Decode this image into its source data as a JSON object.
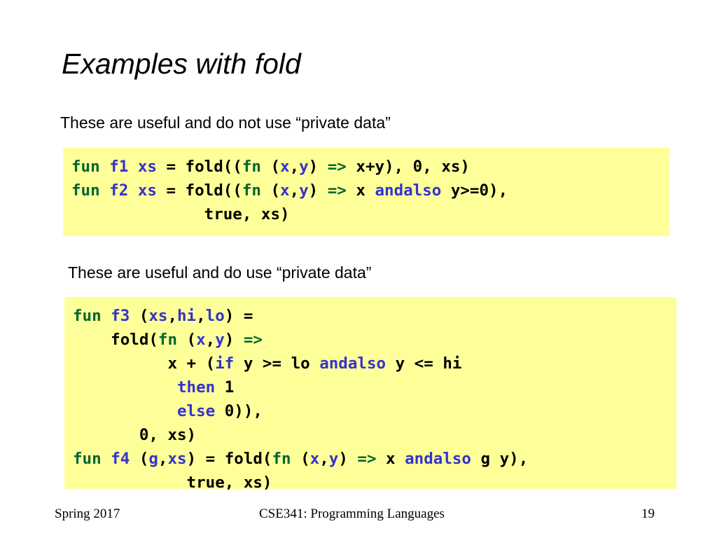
{
  "slide": {
    "title": "Examples with fold",
    "bullets": [
      "These are useful and do not use “private data”",
      "These are useful and do use “private data”"
    ],
    "code_block_1": {
      "background_color": "#ffff99",
      "lines": [
        {
          "tokens": [
            {
              "t": "fun ",
              "c": "keyword"
            },
            {
              "t": "f1 xs",
              "c": "identifier"
            },
            {
              "t": " = fold((",
              "c": "plain"
            },
            {
              "t": "fn",
              "c": "keyword"
            },
            {
              "t": " (",
              "c": "plain"
            },
            {
              "t": "x",
              "c": "identifier"
            },
            {
              "t": ",",
              "c": "plain"
            },
            {
              "t": "y",
              "c": "identifier"
            },
            {
              "t": ") ",
              "c": "plain"
            },
            {
              "t": "=>",
              "c": "keyword"
            },
            {
              "t": " x+y), 0, xs)",
              "c": "plain"
            }
          ]
        },
        {
          "tokens": [
            {
              "t": "fun ",
              "c": "keyword"
            },
            {
              "t": "f2 xs",
              "c": "identifier"
            },
            {
              "t": " = fold((",
              "c": "plain"
            },
            {
              "t": "fn",
              "c": "keyword"
            },
            {
              "t": " (",
              "c": "plain"
            },
            {
              "t": "x",
              "c": "identifier"
            },
            {
              "t": ",",
              "c": "plain"
            },
            {
              "t": "y",
              "c": "identifier"
            },
            {
              "t": ") ",
              "c": "plain"
            },
            {
              "t": "=>",
              "c": "keyword"
            },
            {
              "t": " x ",
              "c": "plain"
            },
            {
              "t": "andalso",
              "c": "control"
            },
            {
              "t": " y>=0),",
              "c": "plain"
            }
          ]
        },
        {
          "tokens": [
            {
              "t": "              true, xs)",
              "c": "plain"
            }
          ]
        }
      ]
    },
    "code_block_2": {
      "background_color": "#ffff99",
      "lines": [
        {
          "tokens": [
            {
              "t": "fun ",
              "c": "keyword"
            },
            {
              "t": "f3",
              "c": "identifier"
            },
            {
              "t": " (",
              "c": "plain"
            },
            {
              "t": "xs",
              "c": "identifier"
            },
            {
              "t": ",",
              "c": "plain"
            },
            {
              "t": "hi",
              "c": "identifier"
            },
            {
              "t": ",",
              "c": "plain"
            },
            {
              "t": "lo",
              "c": "identifier"
            },
            {
              "t": ") =",
              "c": "plain"
            }
          ]
        },
        {
          "tokens": [
            {
              "t": "    fold(",
              "c": "plain"
            },
            {
              "t": "fn",
              "c": "keyword"
            },
            {
              "t": " (",
              "c": "plain"
            },
            {
              "t": "x",
              "c": "identifier"
            },
            {
              "t": ",",
              "c": "plain"
            },
            {
              "t": "y",
              "c": "identifier"
            },
            {
              "t": ") ",
              "c": "plain"
            },
            {
              "t": "=>",
              "c": "keyword"
            }
          ]
        },
        {
          "tokens": [
            {
              "t": "          x + (",
              "c": "plain"
            },
            {
              "t": "if",
              "c": "control"
            },
            {
              "t": " y >= lo ",
              "c": "plain"
            },
            {
              "t": "andalso",
              "c": "control"
            },
            {
              "t": " y <= hi",
              "c": "plain"
            }
          ]
        },
        {
          "tokens": [
            {
              "t": "           ",
              "c": "plain"
            },
            {
              "t": "then",
              "c": "control"
            },
            {
              "t": " 1",
              "c": "plain"
            }
          ]
        },
        {
          "tokens": [
            {
              "t": "           ",
              "c": "plain"
            },
            {
              "t": "else",
              "c": "control"
            },
            {
              "t": " 0)),",
              "c": "plain"
            }
          ]
        },
        {
          "tokens": [
            {
              "t": "       0, xs)",
              "c": "plain"
            }
          ]
        },
        {
          "tokens": [
            {
              "t": "fun ",
              "c": "keyword"
            },
            {
              "t": "f4",
              "c": "identifier"
            },
            {
              "t": " (",
              "c": "plain"
            },
            {
              "t": "g",
              "c": "identifier"
            },
            {
              "t": ",",
              "c": "plain"
            },
            {
              "t": "xs",
              "c": "identifier"
            },
            {
              "t": ") = fold(",
              "c": "plain"
            },
            {
              "t": "fn",
              "c": "keyword"
            },
            {
              "t": " (",
              "c": "plain"
            },
            {
              "t": "x",
              "c": "identifier"
            },
            {
              "t": ",",
              "c": "plain"
            },
            {
              "t": "y",
              "c": "identifier"
            },
            {
              "t": ") ",
              "c": "plain"
            },
            {
              "t": "=>",
              "c": "keyword"
            },
            {
              "t": " x ",
              "c": "plain"
            },
            {
              "t": "andalso",
              "c": "control"
            },
            {
              "t": " g y),",
              "c": "plain"
            }
          ]
        },
        {
          "tokens": [
            {
              "t": "            true, xs)",
              "c": "plain"
            }
          ]
        }
      ]
    }
  },
  "footer": {
    "left": "Spring 2017",
    "center": "CSE341: Programming Languages",
    "right": "19"
  },
  "colors": {
    "keyword_green": "#006633",
    "identifier_blue": "#3333cc",
    "code_background": "#ffff99",
    "text_black": "#000000"
  }
}
